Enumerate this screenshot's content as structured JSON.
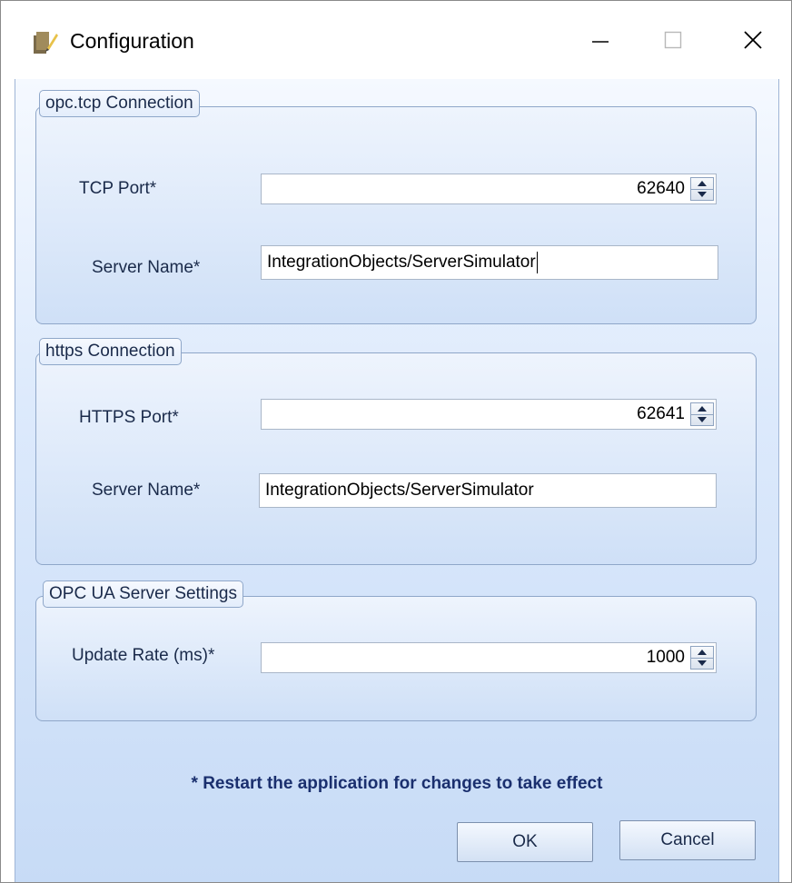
{
  "window": {
    "title": "Configuration",
    "icons": {
      "app": "config-app-icon",
      "minimize": "minimize-icon",
      "maximize": "maximize-icon",
      "close": "close-icon"
    }
  },
  "opc_tcp": {
    "legend": "opc.tcp Connection",
    "port_label": "TCP Port*",
    "port_value": "62640",
    "server_label": "Server Name*",
    "server_value": "IntegrationObjects/ServerSimulator"
  },
  "https": {
    "legend": "https Connection",
    "port_label": "HTTPS Port*",
    "port_value": "62641",
    "server_label": "Server Name*",
    "server_value": "IntegrationObjects/ServerSimulator"
  },
  "opcua_settings": {
    "legend": "OPC UA Server Settings",
    "rate_label": "Update Rate (ms)*",
    "rate_value": "1000"
  },
  "note": "* Restart the application for changes to take effect",
  "buttons": {
    "ok": "OK",
    "cancel": "Cancel"
  },
  "colors": {
    "accent": "#1a2f6e",
    "background_top": "#f5f9ff",
    "background_bottom": "#c7dbf6"
  }
}
